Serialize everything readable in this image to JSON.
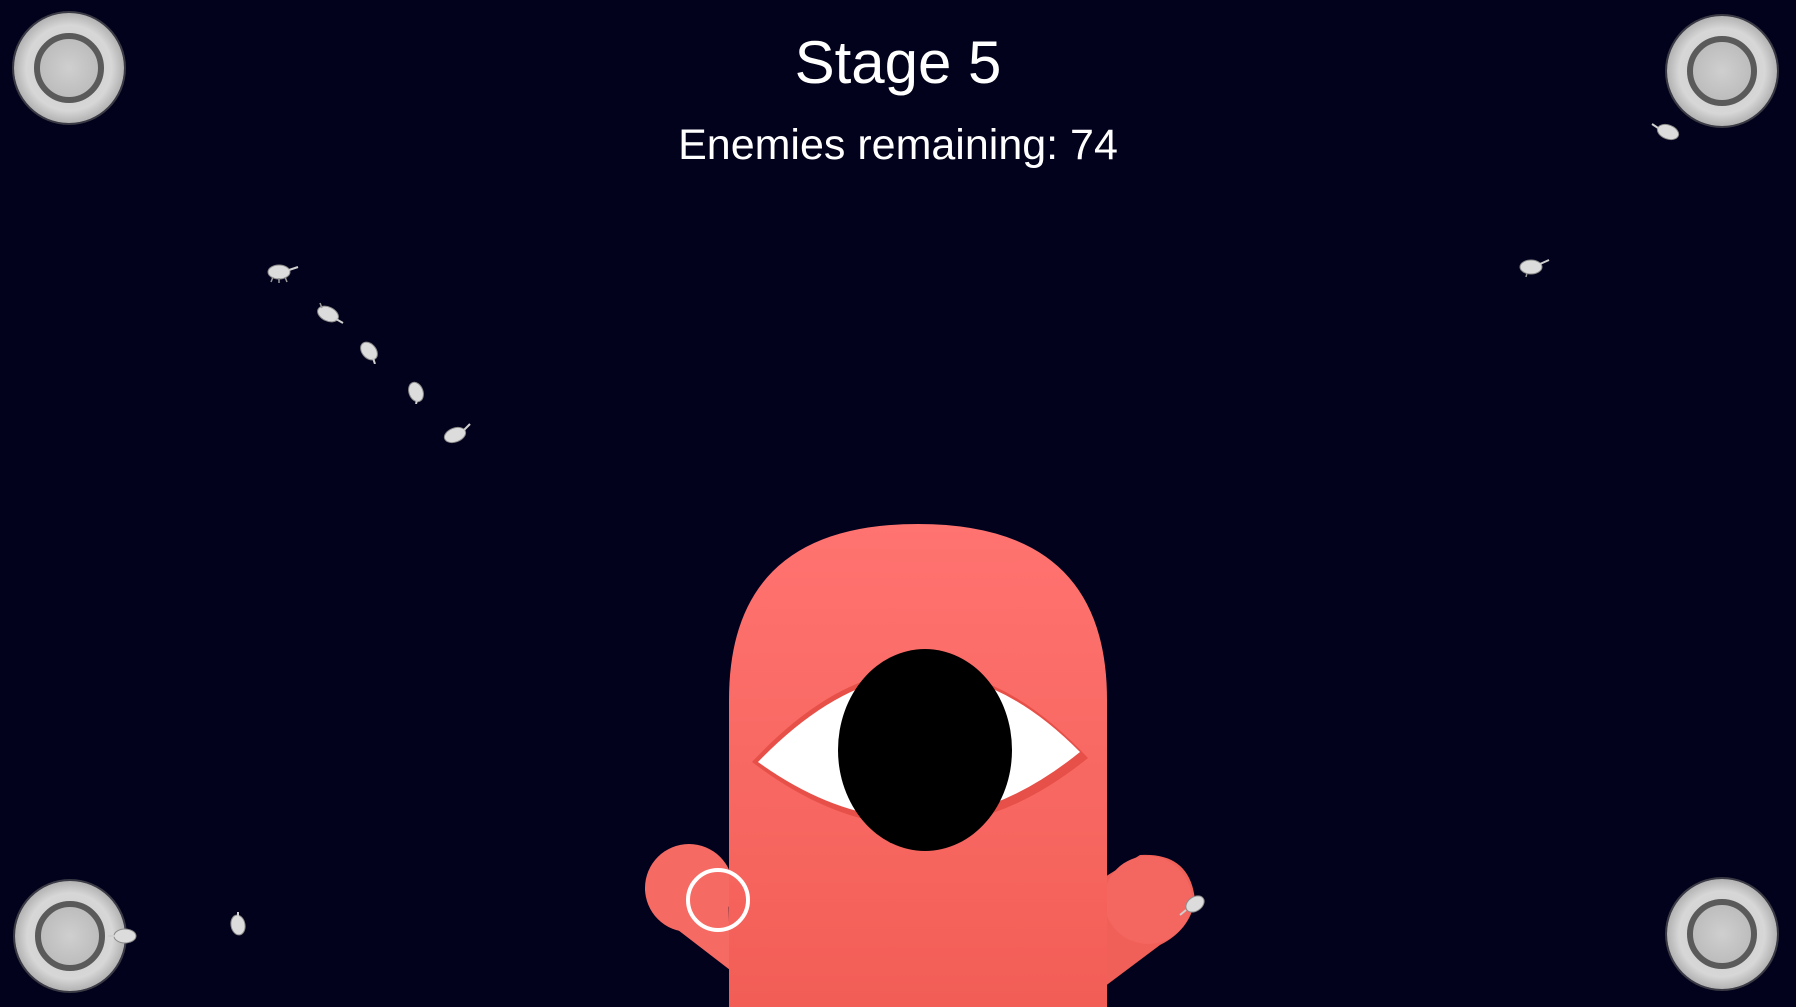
{
  "hud": {
    "stage_label": "Stage 5",
    "enemies_label": "Enemies remaining: 74"
  },
  "colors": {
    "background": "#02021c",
    "monster_body": "#f4625a",
    "monster_eye_white": "#ffffff",
    "monster_pupil": "#000000",
    "enemy": "#d9d9d9",
    "portal": "#c8c8c8"
  },
  "icons": {
    "portal": "spawn-portal-icon",
    "enemy": "bug-enemy-icon",
    "crosshair": "aim-reticle-icon"
  }
}
